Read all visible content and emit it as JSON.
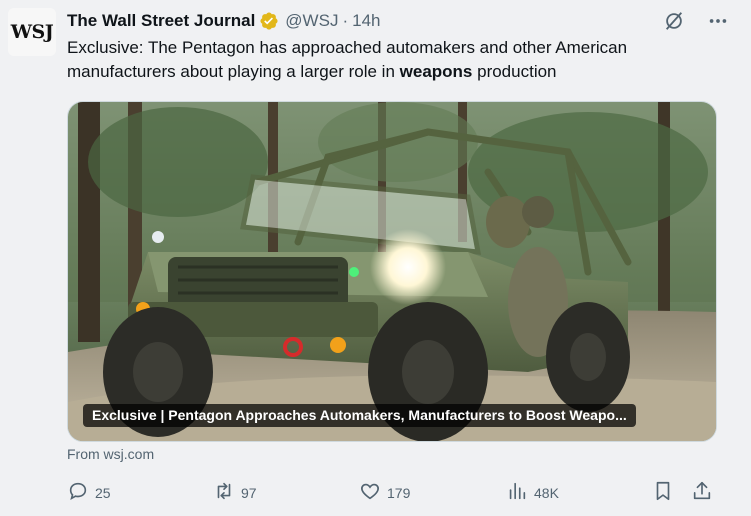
{
  "account": {
    "avatar_text": "WSJ",
    "display_name": "The Wall Street Journal",
    "handle": "@WSJ",
    "separator": "·",
    "time": "14h",
    "verified_badge_color": "#e2b719"
  },
  "tweet": {
    "text_before": "Exclusive: The Pentagon has approached automakers and other American manufacturers about playing a larger role in ",
    "text_bold": "weapons",
    "text_after": " production"
  },
  "card": {
    "title": "Exclusive | Pentagon Approaches Automakers, Manufacturers to Boost Weapo...",
    "from": "From wsj.com",
    "image_description_icon": "military-vehicle-photo"
  },
  "actions": {
    "replies": "25",
    "reposts": "97",
    "likes": "179",
    "views": "48K"
  },
  "icons": {
    "grok": "grok-icon",
    "more": "more-icon",
    "reply": "reply-icon",
    "repost": "repost-icon",
    "like": "like-icon",
    "views": "views-icon",
    "bookmark": "bookmark-icon",
    "share": "share-icon"
  },
  "colors": {
    "text": "#0f1419",
    "secondary": "#536471",
    "background": "#f0f1f3"
  }
}
